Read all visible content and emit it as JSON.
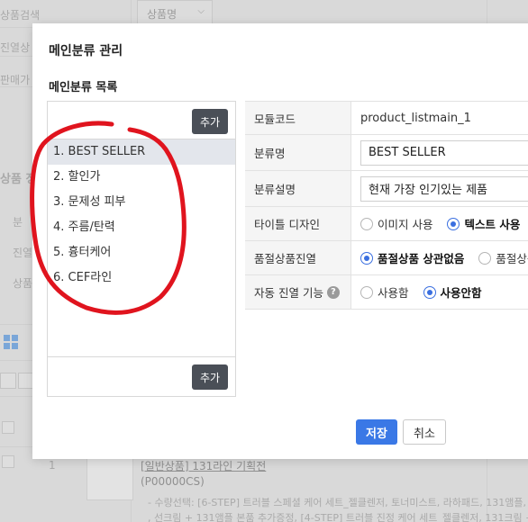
{
  "background": {
    "labels": [
      "상품검색",
      "진열상",
      "판매가",
      "상품 정",
      "분",
      "진열",
      "상품"
    ],
    "filter_select": "상품명",
    "row_number": "1",
    "product_link": "[일반상품] 131라인 기획전",
    "product_code": "(P00000CS)",
    "option_line_1": "- 수량선택: [6-STEP] 트러블 스페셜 케어 세트_젤클렌저, 토너미스트, 라하패드, 131앰플,",
    "option_line_2": ", 선크림 + 131앰플 본품 추가증정, [4-STEP] 트러블 진정 케어 세트_젤클렌저, 131크림 +"
  },
  "modal": {
    "title": "메인분류 관리",
    "section_title": "메인분류 목록",
    "add_button_top": "추가",
    "add_button_bottom": "추가",
    "categories": [
      {
        "label": "1. BEST SELLER",
        "active": true
      },
      {
        "label": "2. 할인가",
        "active": false
      },
      {
        "label": "3. 문제성 피부",
        "active": false
      },
      {
        "label": "4. 주름/탄력",
        "active": false
      },
      {
        "label": "5. 흉터케어",
        "active": false
      },
      {
        "label": "6. CEF라인",
        "active": false
      }
    ],
    "form": {
      "module_code_label": "모듈코드",
      "module_code_value": "product_listmain_1",
      "category_name_label": "분류명",
      "category_name_value": "BEST SELLER",
      "category_desc_label": "분류설명",
      "category_desc_value": "현재 가장 인기있는 제품",
      "title_design_label": "타이틀 디자인",
      "title_design_options": [
        "이미지 사용",
        "텍스트 사용"
      ],
      "title_design_selected": 1,
      "soldout_label": "품절상품진열",
      "soldout_options": [
        "품절상품 상관없음",
        "품절상품"
      ],
      "soldout_selected": 0,
      "auto_display_label": "자동 진열 기능",
      "auto_display_help": "?",
      "auto_display_options": [
        "사용함",
        "사용안함"
      ],
      "auto_display_selected": 1
    },
    "save_button": "저장",
    "cancel_button": "취소"
  },
  "colors": {
    "primary": "#3a78e6",
    "dark_button": "#4a4f57",
    "annotation_red": "#e0141e",
    "active_row": "#e3e6ec"
  }
}
